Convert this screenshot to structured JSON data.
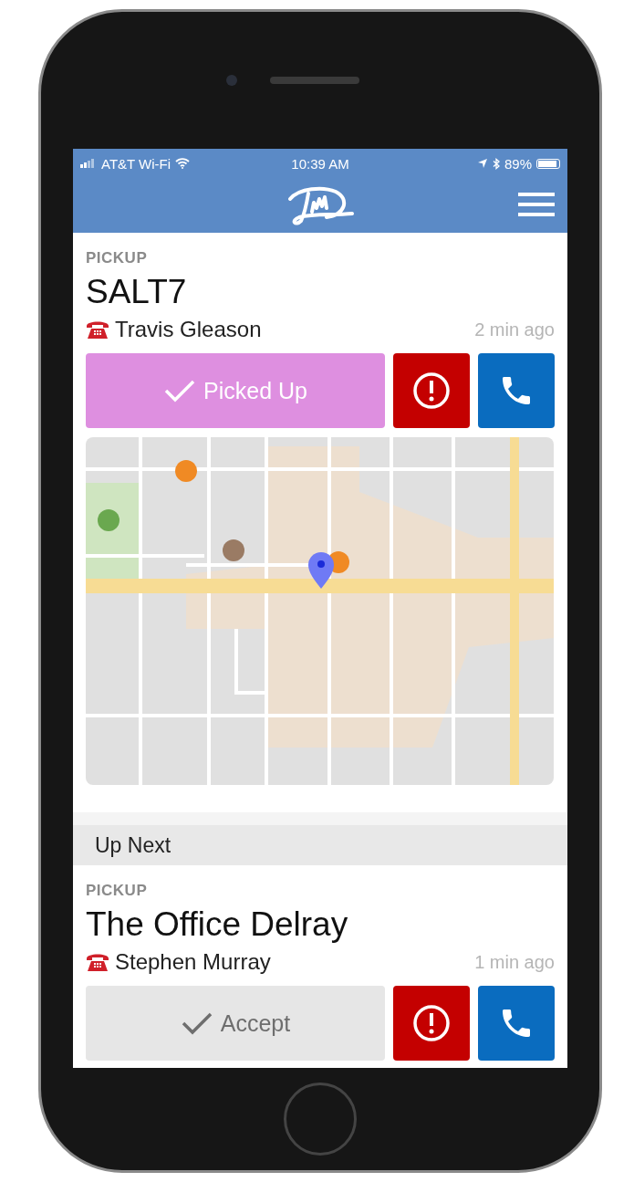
{
  "status_bar": {
    "carrier": "AT&T Wi-Fi",
    "time": "10:39 AM",
    "battery": "89%"
  },
  "current": {
    "type": "PICKUP",
    "name": "SALT7",
    "contact": "Travis Gleason",
    "time": "2 min ago",
    "action": {
      "label": "Picked Up",
      "kind": "picked_up"
    }
  },
  "up_next": {
    "title": "Up Next",
    "items": [
      {
        "type": "PICKUP",
        "name": "The Office Delray",
        "contact": "Stephen Murray",
        "time": "1 min ago",
        "action": {
          "label": "Accept",
          "kind": "accept"
        }
      }
    ]
  }
}
